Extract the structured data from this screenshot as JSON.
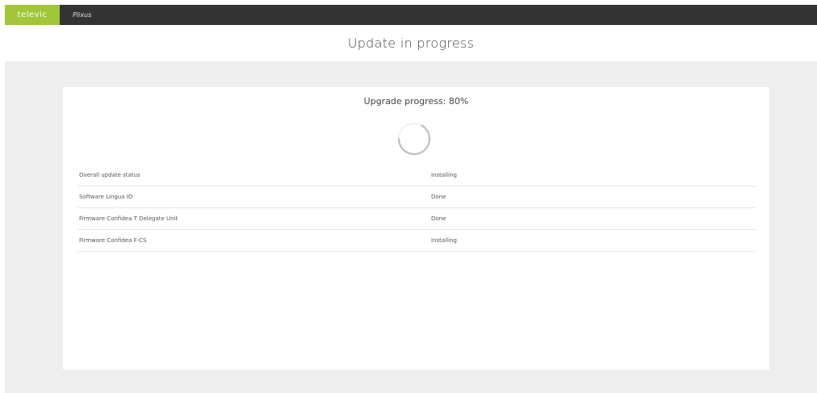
{
  "topbar": {
    "brand": "televic",
    "product": "Plixus"
  },
  "header": {
    "title": "Update in progress"
  },
  "progress": {
    "label": "Upgrade progress: 80%",
    "percent": 80
  },
  "status_rows": [
    {
      "name": "Overall update status",
      "status": "Installing"
    },
    {
      "name": "Software Lingua ID",
      "status": "Done"
    },
    {
      "name": "Firmware Confidea T Delegate Unit",
      "status": "Done"
    },
    {
      "name": "Firmware Confidea F-CS",
      "status": "Installing"
    }
  ],
  "colors": {
    "brand": "#a1c639",
    "topbar": "#333333",
    "background": "#eeeeee"
  },
  "icons": {
    "spinner": "loading-spinner-icon"
  }
}
